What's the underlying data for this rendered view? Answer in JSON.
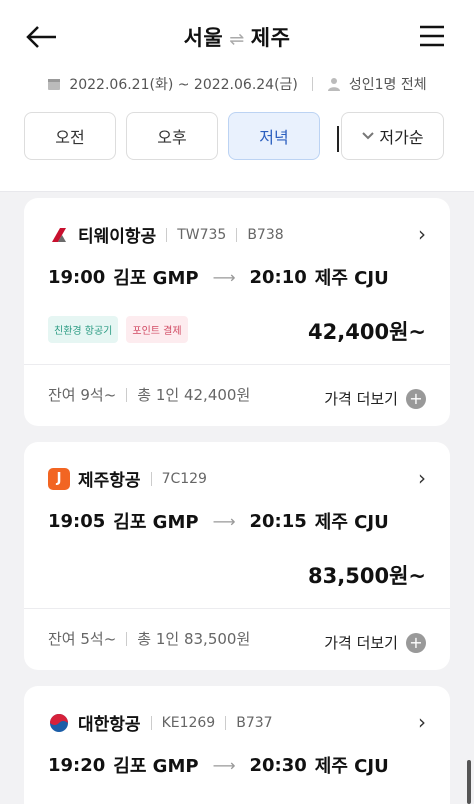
{
  "header": {
    "from": "서울",
    "swap": "⇌",
    "to": "제주",
    "dates": "2022.06.21(화) ~ 2022.06.24(금)",
    "passengers": "성인1명 전체"
  },
  "filters": [
    "오전",
    "오후",
    "저녁"
  ],
  "active_filter": "저녁",
  "sort": {
    "label": "저가순"
  },
  "flights": [
    {
      "airline": "티웨이항공",
      "flight_no": "TW735",
      "aircraft": "B738",
      "logo_color": "#c8102e",
      "logo_char": "t",
      "dep_time": "19:00",
      "dep_airport": "김포 GMP",
      "arr_time": "20:10",
      "arr_airport": "제주 CJU",
      "tags": [
        "친환경 항공기",
        "포인트 결제"
      ],
      "price": "42,400원~",
      "seats": "잔여 9석~",
      "total": "총 1인 42,400원",
      "more": "가격 더보기"
    },
    {
      "airline": "제주항공",
      "flight_no": "7C129",
      "aircraft": "",
      "logo_color": "#f26522",
      "logo_char": "J",
      "dep_time": "19:05",
      "dep_airport": "김포 GMP",
      "arr_time": "20:15",
      "arr_airport": "제주 CJU",
      "tags": [],
      "price": "83,500원~",
      "seats": "잔여 5석~",
      "total": "총 1인 83,500원",
      "more": "가격 더보기"
    },
    {
      "airline": "대한항공",
      "flight_no": "KE1269",
      "aircraft": "B737",
      "logo_color": "#1b5ea8",
      "logo_char": "",
      "dep_time": "19:20",
      "dep_airport": "김포 GMP",
      "arr_time": "20:30",
      "arr_airport": "제주 CJU"
    }
  ]
}
